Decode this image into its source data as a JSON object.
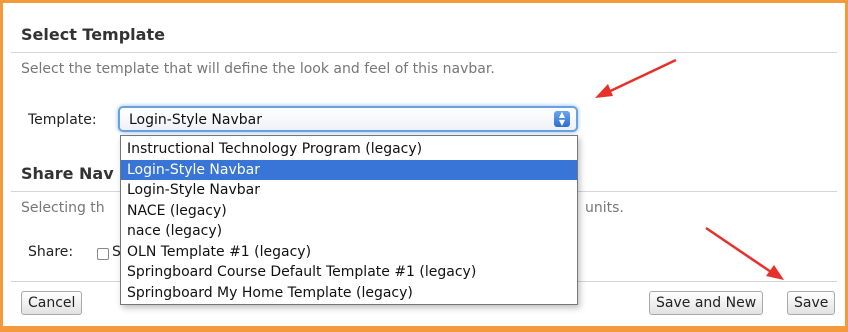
{
  "section": {
    "title": "Select Template",
    "description": "Select the template that will define the look and feel of this navbar."
  },
  "template_field": {
    "label": "Template:",
    "selected": "Login-Style Navbar",
    "options": [
      "Instructional Technology Program (legacy)",
      "Login-Style Navbar",
      "Login-Style Navbar",
      "NACE (legacy)",
      "nace (legacy)",
      "OLN Template #1 (legacy)",
      "Springboard Course Default Template #1 (legacy)",
      "Springboard My Home Template (legacy)"
    ],
    "highlighted_index": 1
  },
  "share_section": {
    "title_visible": "Share Nav",
    "description_visible_start": "Selecting th",
    "description_visible_end": "units.",
    "label": "Share:",
    "checkbox_label_visible": "S"
  },
  "buttons": {
    "cancel": "Cancel",
    "save_and_new": "Save and New",
    "save": "Save"
  },
  "colors": {
    "frame_border": "#f39a3c",
    "highlight": "#3875d7",
    "annotation_arrow": "#e8302a"
  }
}
